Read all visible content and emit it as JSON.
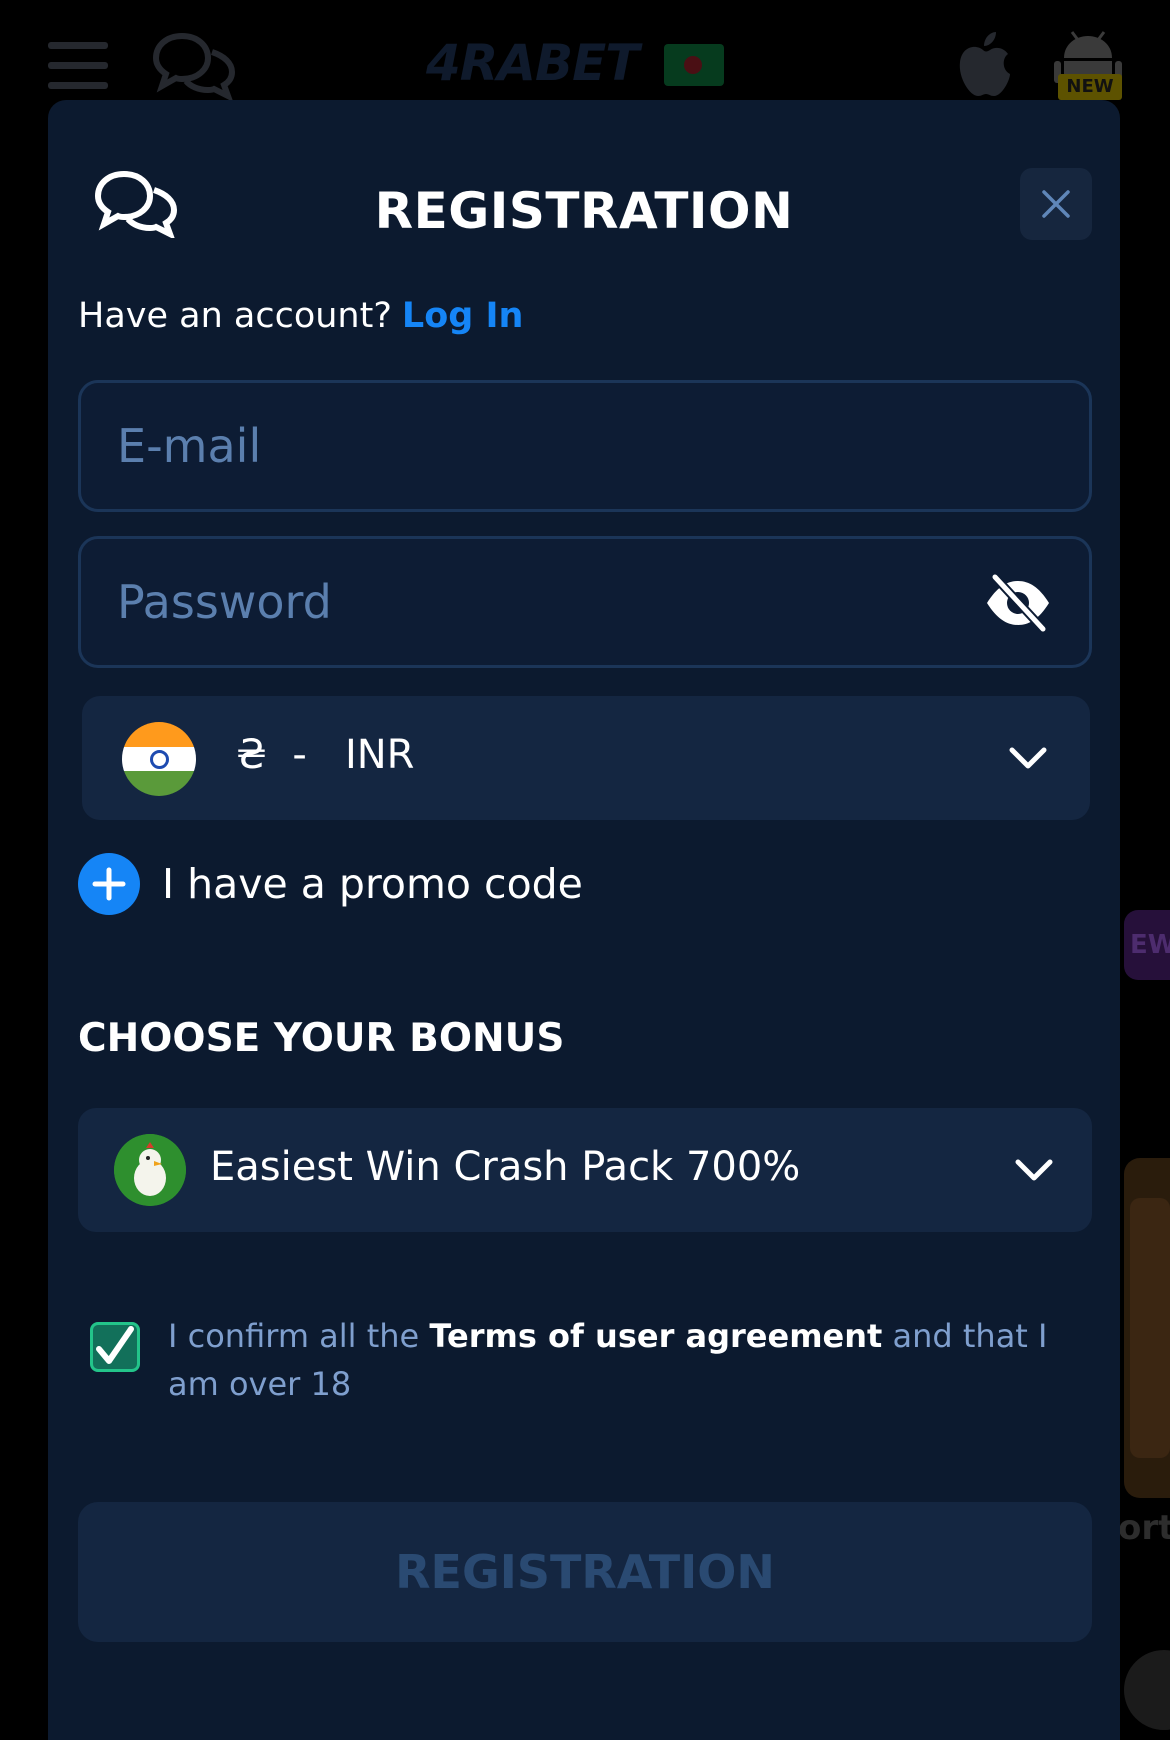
{
  "header": {
    "logo_text": "4RABET",
    "new_badge": "NEW"
  },
  "modal": {
    "title": "REGISTRATION",
    "account_prompt": "Have an account?",
    "login_link": "Log In",
    "email": {
      "placeholder": "E-mail",
      "value": ""
    },
    "password": {
      "placeholder": "Password",
      "value": ""
    },
    "currency": {
      "selected": "₴  -   INR"
    },
    "promo_label": "I have a promo code",
    "bonus_heading": "CHOOSE YOUR BONUS",
    "bonus": {
      "selected": "Easiest Win Crash Pack 700%"
    },
    "terms": {
      "prefix": "I confirm all the",
      "link": "Terms of user agreement",
      "suffix": "and that I am over 18",
      "checked": true
    },
    "submit_label": "REGISTRATION"
  },
  "background": {
    "new_label": "EW",
    "peek_text": "ort"
  },
  "colors": {
    "modal_bg": "#0c1a2f",
    "accent": "#1585f6",
    "field_border": "#1b3558",
    "checkbox": "#23c48a"
  },
  "icons": [
    "menu-icon",
    "chat-icon",
    "apple-icon",
    "android-icon",
    "close-icon",
    "eye-off-icon",
    "chevron-down-icon",
    "plus-icon",
    "check-icon",
    "india-flag-icon"
  ]
}
